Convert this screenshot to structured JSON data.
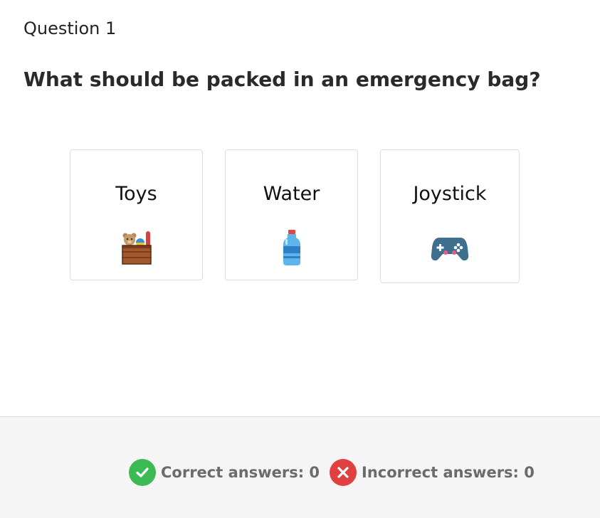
{
  "question": {
    "number_label": "Question 1",
    "text": "What should be packed in an emergency bag?"
  },
  "options": [
    {
      "label": "Toys",
      "icon": "toy-box-icon"
    },
    {
      "label": "Water",
      "icon": "water-bottle-icon"
    },
    {
      "label": "Joystick",
      "icon": "gamepad-icon"
    }
  ],
  "score": {
    "correct_label": "Correct answers: 0",
    "incorrect_label": "Incorrect answers: 0",
    "correct_color": "#3cba54",
    "incorrect_color": "#e04040"
  }
}
